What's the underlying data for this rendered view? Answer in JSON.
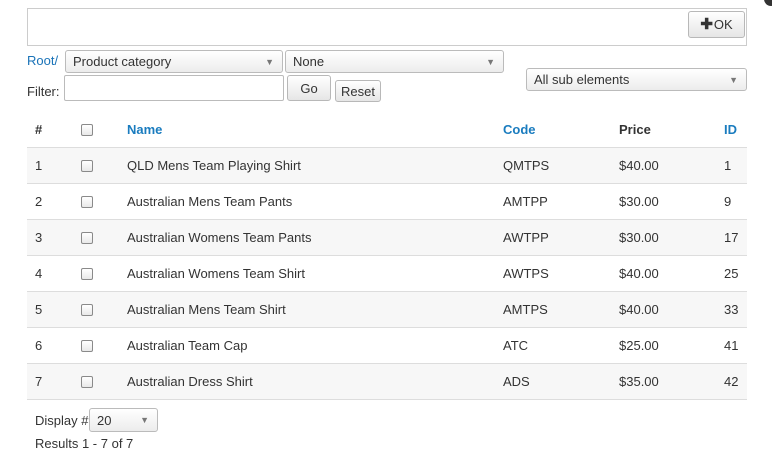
{
  "toolbar": {
    "ok_label": "OK",
    "ok_icon": "plus-icon"
  },
  "breadcrumb": {
    "root_label": "Root/"
  },
  "selects": {
    "category": "Product category",
    "subcategory": "None",
    "scope": "All sub elements"
  },
  "filter": {
    "label": "Filter:",
    "value": "",
    "go_label": "Go",
    "reset_label": "Reset"
  },
  "table": {
    "headers": {
      "num": "#",
      "name": "Name",
      "code": "Code",
      "price": "Price",
      "id": "ID"
    },
    "rows": [
      {
        "num": "1",
        "name": "QLD Mens Team Playing Shirt",
        "code": "QMTPS",
        "price": "$40.00",
        "id": "1"
      },
      {
        "num": "2",
        "name": "Australian Mens Team Pants",
        "code": "AMTPP",
        "price": "$30.00",
        "id": "9"
      },
      {
        "num": "3",
        "name": "Australian Womens Team Pants",
        "code": "AWTPP",
        "price": "$30.00",
        "id": "17"
      },
      {
        "num": "4",
        "name": "Australian Womens Team Shirt",
        "code": "AWTPS",
        "price": "$40.00",
        "id": "25"
      },
      {
        "num": "5",
        "name": "Australian Mens Team Shirt",
        "code": "AMTPS",
        "price": "$40.00",
        "id": "33"
      },
      {
        "num": "6",
        "name": "Australian Team Cap",
        "code": "ATC",
        "price": "$25.00",
        "id": "41"
      },
      {
        "num": "7",
        "name": "Australian Dress Shirt",
        "code": "ADS",
        "price": "$35.00",
        "id": "42"
      }
    ]
  },
  "pagination": {
    "display_label": "Display #",
    "page_size": "20",
    "results_text": "Results 1 - 7 of 7"
  },
  "colors": {
    "link": "#1a7cbf",
    "row_alt": "#f7f7f7",
    "border": "#dddddd"
  }
}
